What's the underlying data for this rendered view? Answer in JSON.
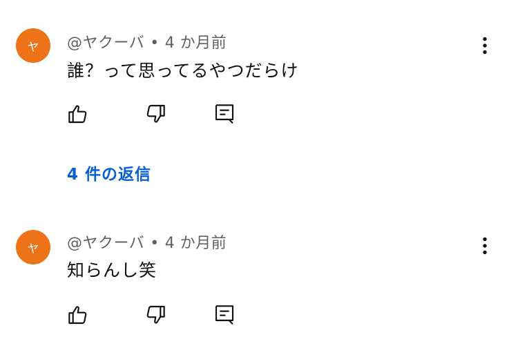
{
  "comments": [
    {
      "avatar_letter": "ヤ",
      "author": "@ヤクーバ",
      "separator": "•",
      "time": "4 か月前",
      "text": "誰？って思ってるやつだらけ",
      "replies_label": "4 件の返信"
    },
    {
      "avatar_letter": "ヤ",
      "author": "@ヤクーバ",
      "separator": "•",
      "time": "4 か月前",
      "text": "知らんし笑"
    }
  ],
  "colors": {
    "avatar_bg": "#ee7318",
    "meta_text": "#606060",
    "link": "#065fd4"
  },
  "icons": {
    "like": "thumb-up-icon",
    "dislike": "thumb-down-icon",
    "reply": "comment-reply-icon",
    "menu": "more-vert-icon"
  }
}
